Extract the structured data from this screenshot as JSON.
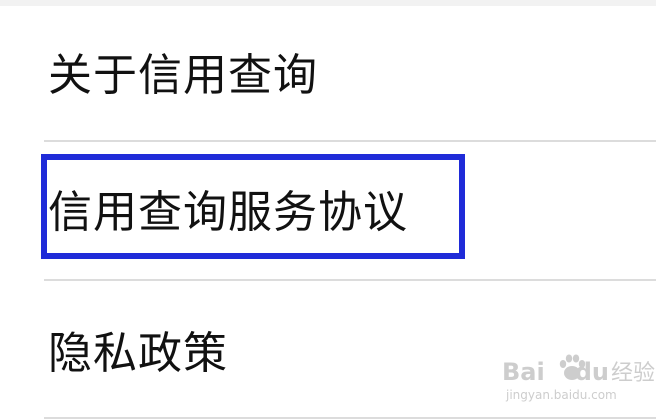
{
  "menu": {
    "items": [
      {
        "label": "关于信用查询"
      },
      {
        "label": "信用查询服务协议"
      },
      {
        "label": "隐私政策"
      }
    ]
  },
  "highlight": {
    "color": "#1f2bd8"
  },
  "watermark": {
    "brand_left": "Bai",
    "brand_right": "du",
    "brand_cn": "经验",
    "url": "jingyan.baidu.com"
  }
}
